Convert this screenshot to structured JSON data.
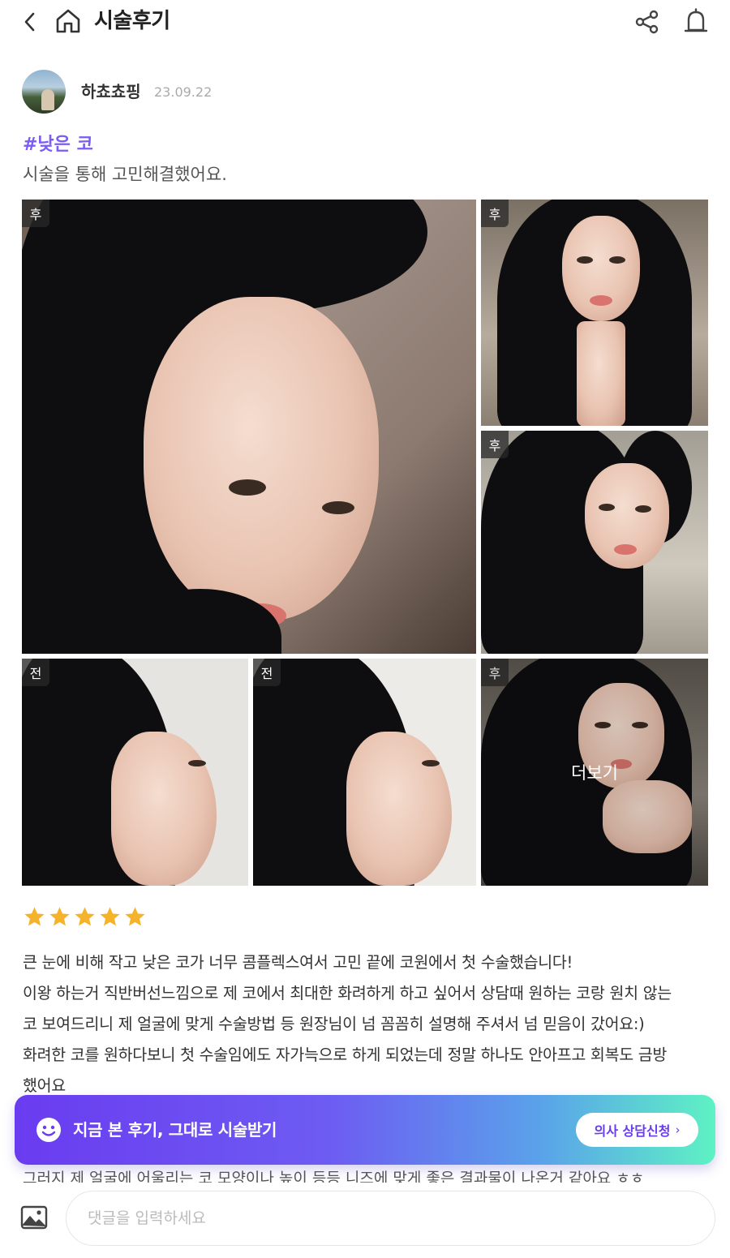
{
  "header": {
    "title": "시술후기",
    "back_icon": "chevron-left-icon",
    "home_icon": "home-icon",
    "share_icon": "share-icon",
    "bell_icon": "bell-icon"
  },
  "author": {
    "name": "하쵸쵸핑",
    "date": "23.09.22"
  },
  "post": {
    "tag": "#낮은 코",
    "summary": "시술을 통해 고민해결했어요."
  },
  "photos": [
    {
      "badge": "후"
    },
    {
      "badge": "후"
    },
    {
      "badge": "후"
    },
    {
      "badge": "전"
    },
    {
      "badge": "전"
    },
    {
      "badge": "후",
      "overlay": "더보기"
    }
  ],
  "rating": {
    "stars": 5,
    "star_color": "#f5b32b"
  },
  "review": {
    "line1": "큰 눈에 비해 작고 낮은 코가 너무 콤플렉스여서 고민 끝에 코원에서 첫 수술했습니다!",
    "line2": "이왕 하는거 직반버선느낌으로 제 코에서 최대한 화려하게 하고 싶어서 상담때 원하는 코랑 원치 않는",
    "line3": "코 보여드리니 제 얼굴에 맞게 수술방법 등 원장님이 넘 꼼꼼히 설명해 주셔서 넘 믿음이 갔어요:)",
    "line4": "화려한 코를 원하다보니 첫 수술임에도 자가늑으로 하게 되었는데 정말 하나도 안아프고 회복도 금방",
    "line5": "했어요",
    "cut_line": "그러지 제 얼굴에 어울리는 코 모양이나 높이 등등 니즈에 맞게 좋은 결과물이 나온거 같아요 ㅎㅎ"
  },
  "cta": {
    "icon": "smile-icon",
    "text": "지금 본 후기, 그대로 시술받기",
    "button_label": "의사 상담신청",
    "button_chevron": "›",
    "accent": "#6a3cf0"
  },
  "comment": {
    "image_icon": "image-icon",
    "placeholder": "댓글을 입력하세요"
  }
}
